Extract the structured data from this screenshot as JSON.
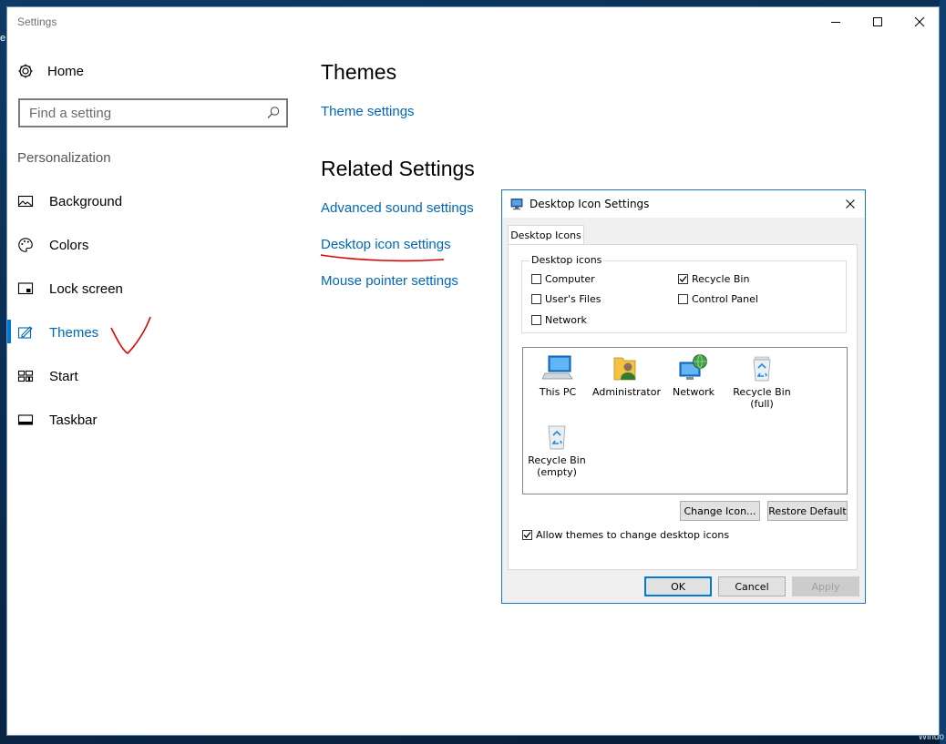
{
  "desktop": {
    "edge_glyph": "e",
    "corner_text": "Windo"
  },
  "window": {
    "title": "Settings"
  },
  "sidebar": {
    "home_label": "Home",
    "search_placeholder": "Find a setting",
    "section_label": "Personalization",
    "items": [
      {
        "label": "Background",
        "icon": "background-icon",
        "active": false
      },
      {
        "label": "Colors",
        "icon": "palette-icon",
        "active": false
      },
      {
        "label": "Lock screen",
        "icon": "lock-screen-icon",
        "active": false
      },
      {
        "label": "Themes",
        "icon": "themes-icon",
        "active": true
      },
      {
        "label": "Start",
        "icon": "start-icon",
        "active": false
      },
      {
        "label": "Taskbar",
        "icon": "taskbar-icon",
        "active": false
      }
    ]
  },
  "main": {
    "title": "Themes",
    "theme_settings_link": "Theme settings",
    "related_title": "Related Settings",
    "related_links": [
      "Advanced sound settings",
      "Desktop icon settings",
      "Mouse pointer settings"
    ]
  },
  "dialog": {
    "title": "Desktop Icon Settings",
    "tab_label": "Desktop Icons",
    "group_label": "Desktop icons",
    "checkboxes": [
      {
        "label": "Computer",
        "checked": false
      },
      {
        "label": "Recycle Bin",
        "checked": true
      },
      {
        "label": "User's Files",
        "checked": false
      },
      {
        "label": "Control Panel",
        "checked": false
      },
      {
        "label": "Network",
        "checked": false
      }
    ],
    "icons": [
      {
        "label_lines": [
          "This PC"
        ],
        "icon": "this-pc-icon"
      },
      {
        "label_lines": [
          "Administrator"
        ],
        "icon": "user-folder-icon"
      },
      {
        "label_lines": [
          "Network"
        ],
        "icon": "network-icon"
      },
      {
        "label_lines": [
          "Recycle Bin",
          "(full)"
        ],
        "icon": "recycle-bin-full-icon"
      },
      {
        "label_lines": [
          "Recycle Bin",
          "(empty)"
        ],
        "icon": "recycle-bin-empty-icon"
      }
    ],
    "change_icon_label": "Change Icon...",
    "restore_default_label": "Restore Default",
    "allow_themes_label": "Allow themes to change desktop icons",
    "allow_themes_checked": true,
    "ok_label": "OK",
    "cancel_label": "Cancel",
    "apply_label": "Apply"
  },
  "colors": {
    "accent": "#0078d7",
    "link": "#0067b8",
    "annotation": "#e00000"
  }
}
